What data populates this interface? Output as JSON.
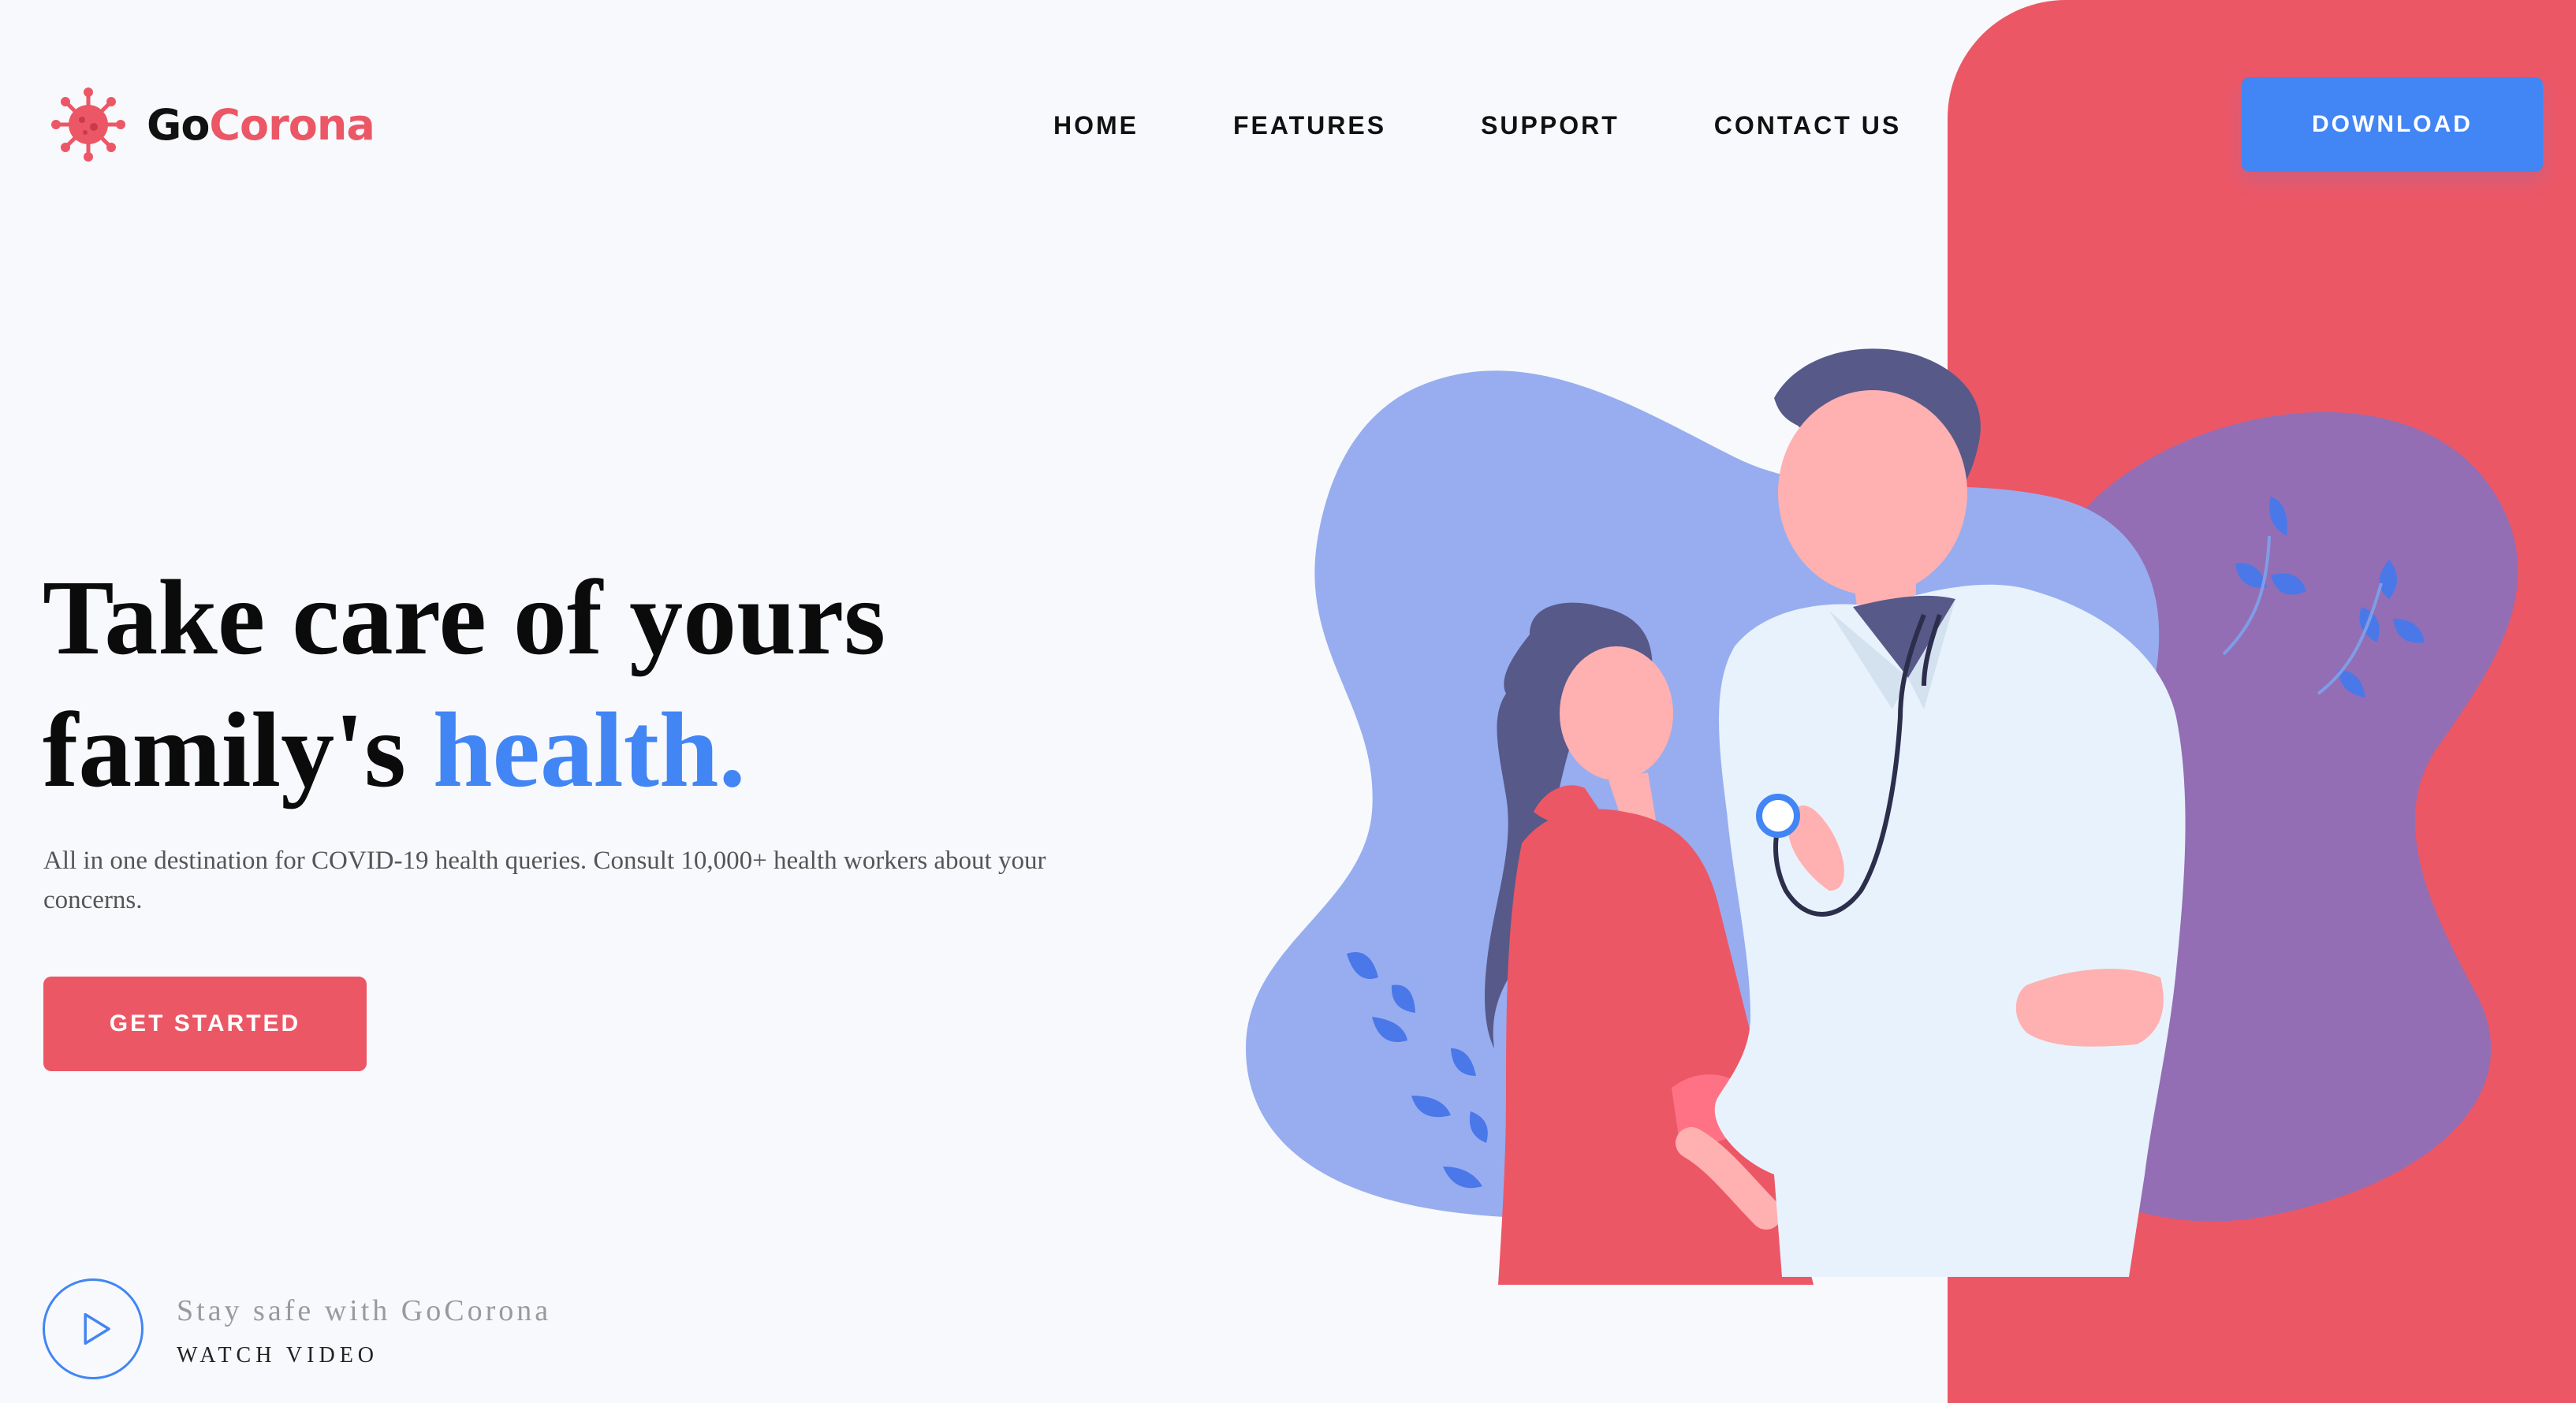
{
  "brand": {
    "name_part1": "Go",
    "name_part2": "Corona",
    "logo_icon": "virus-icon"
  },
  "nav": {
    "items": [
      {
        "label": "HOME"
      },
      {
        "label": "FEATURES"
      },
      {
        "label": "SUPPORT"
      },
      {
        "label": "CONTACT US"
      }
    ],
    "download_label": "DOWNLOAD"
  },
  "hero": {
    "title_line1": "Take care of yours",
    "title_line2_prefix": "family's ",
    "title_highlight": "health.",
    "subtitle": "All in one destination for COVID-19 health queries. Consult 10,000+ health workers about your concerns.",
    "cta_label": "GET STARTED"
  },
  "video": {
    "caption": "Stay safe with GoCorona",
    "link_label": "WATCH VIDEO",
    "icon": "play-icon"
  },
  "illustration": {
    "subject": "doctor-examining-girl-illustration"
  },
  "colors": {
    "accent_red": "#ec5766",
    "accent_blue": "#4285f4",
    "blob_blue": "#97adf0",
    "blob_purple": "#936eb4",
    "background": "#f8f9fc",
    "text_dark": "#111111"
  }
}
